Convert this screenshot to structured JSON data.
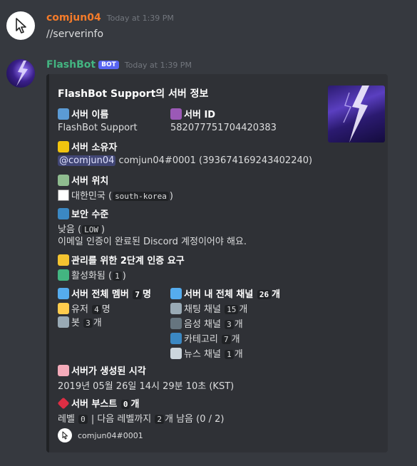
{
  "messages": [
    {
      "username": "comjun04",
      "timestamp": "Today at 1:39 PM",
      "text": "//serverinfo"
    },
    {
      "username": "FlashBot",
      "bot_tag": "BOT",
      "timestamp": "Today at 1:39 PM"
    }
  ],
  "embed": {
    "title": "FlashBot Support의 서버 정보",
    "server_name": {
      "label": "서버 이름",
      "value": "FlashBot Support"
    },
    "server_id": {
      "label": "서버 ID",
      "value": "582077751704420383"
    },
    "owner": {
      "label": "서버 소유자",
      "mention": "@comjun04",
      "value": "comjun04#0001 (393674169243402240)"
    },
    "region": {
      "label": "서버 위치",
      "name": "대한민국",
      "code": "south-korea"
    },
    "verification": {
      "label": "보안 수준",
      "level": "낮음",
      "code": "LOW",
      "desc": "이메일 인증이 완료된 Discord 계정이어야 해요."
    },
    "mfa": {
      "label": "관리를 위한 2단계 인증 요구",
      "status": "활성화됨",
      "code": "1"
    },
    "members": {
      "label_pre": "서버 전체 멤버",
      "count": "7",
      "label_post": "명",
      "users_label": "유저",
      "users": "4",
      "users_unit": "명",
      "bots_label": "봇",
      "bots": "3",
      "bots_unit": "개"
    },
    "channels": {
      "label_pre": "서버 내 전체 채널",
      "count": "26",
      "label_post": "개",
      "text_label": "채팅 채널",
      "text": "15",
      "text_unit": "개",
      "voice_label": "음성 채널",
      "voice": "3",
      "voice_unit": "개",
      "category_label": "카테고리",
      "category": "7",
      "category_unit": "개",
      "news_label": "뉴스 채널",
      "news": "1",
      "news_unit": "개"
    },
    "created": {
      "label": "서버가 생성된 시각",
      "value": "2019년 05월 26일 14시 29분 10초 (KST)"
    },
    "boost": {
      "label_pre": "서버 부스트",
      "count": "0",
      "label_post": "개",
      "level_label": "레벨",
      "level": "0",
      "mid": "| 다음 레벨까지",
      "need": "2",
      "tail": "개 남음 (0 / 2)"
    },
    "footer": "comjun04#0001"
  },
  "colors": {
    "bg": "#36393f",
    "embed_bg": "#2f3136",
    "user_name": "#f47b2a",
    "bot_name": "#43b581",
    "bot_tag": "#5865f2"
  },
  "icons": [
    "cursor-avatar-icon",
    "lightning-avatar-icon",
    "desktop-icon",
    "id-icon",
    "crown-icon",
    "map-icon",
    "korea-flag-icon",
    "shield-icon",
    "lock-icon",
    "check-icon",
    "people-icon",
    "chat-icon",
    "person-icon",
    "robot-icon",
    "keyboard-icon",
    "microphone-icon",
    "folder-icon",
    "newspaper-icon",
    "cake-icon",
    "diamond-icon"
  ]
}
